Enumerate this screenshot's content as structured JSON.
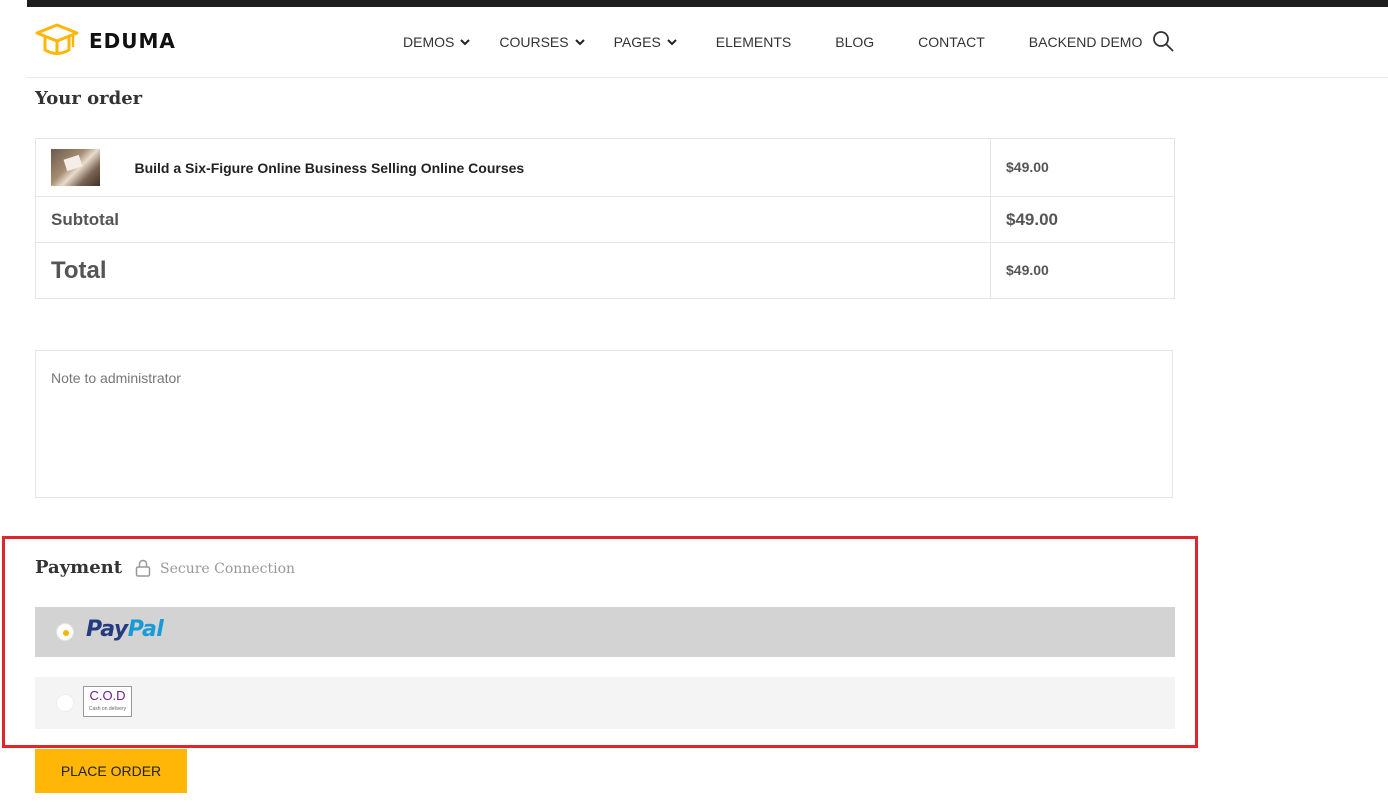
{
  "header": {
    "logo_text": "EDUMA",
    "nav": [
      {
        "label": "DEMOS",
        "dropdown": true
      },
      {
        "label": "COURSES",
        "dropdown": true
      },
      {
        "label": "PAGES",
        "dropdown": true
      },
      {
        "label": "ELEMENTS",
        "dropdown": false
      },
      {
        "label": "BLOG",
        "dropdown": false
      },
      {
        "label": "CONTACT",
        "dropdown": false
      },
      {
        "label": "BACKEND DEMO",
        "dropdown": false
      }
    ]
  },
  "order": {
    "heading": "Your order",
    "item": {
      "title": "Build a Six-Figure Online Business Selling Online Courses",
      "price": "$49.00"
    },
    "subtotal_label": "Subtotal",
    "subtotal_value": "$49.00",
    "total_label": "Total",
    "total_value": "$49.00"
  },
  "note": {
    "placeholder": "Note to administrator"
  },
  "payment": {
    "title": "Payment",
    "secure_label": "Secure Connection",
    "methods": [
      {
        "id": "paypal",
        "logo_part1": "Pay",
        "logo_part2": "Pal",
        "selected": true
      },
      {
        "id": "cod",
        "logo_main": "C.O.D",
        "logo_sub": "Cash on delivery",
        "selected": false
      }
    ]
  },
  "actions": {
    "place_order": "PLACE ORDER"
  },
  "colors": {
    "accent": "#ffb606",
    "highlight_border": "#e0262a",
    "paypal_dark": "#253b80",
    "paypal_light": "#179bd7"
  }
}
